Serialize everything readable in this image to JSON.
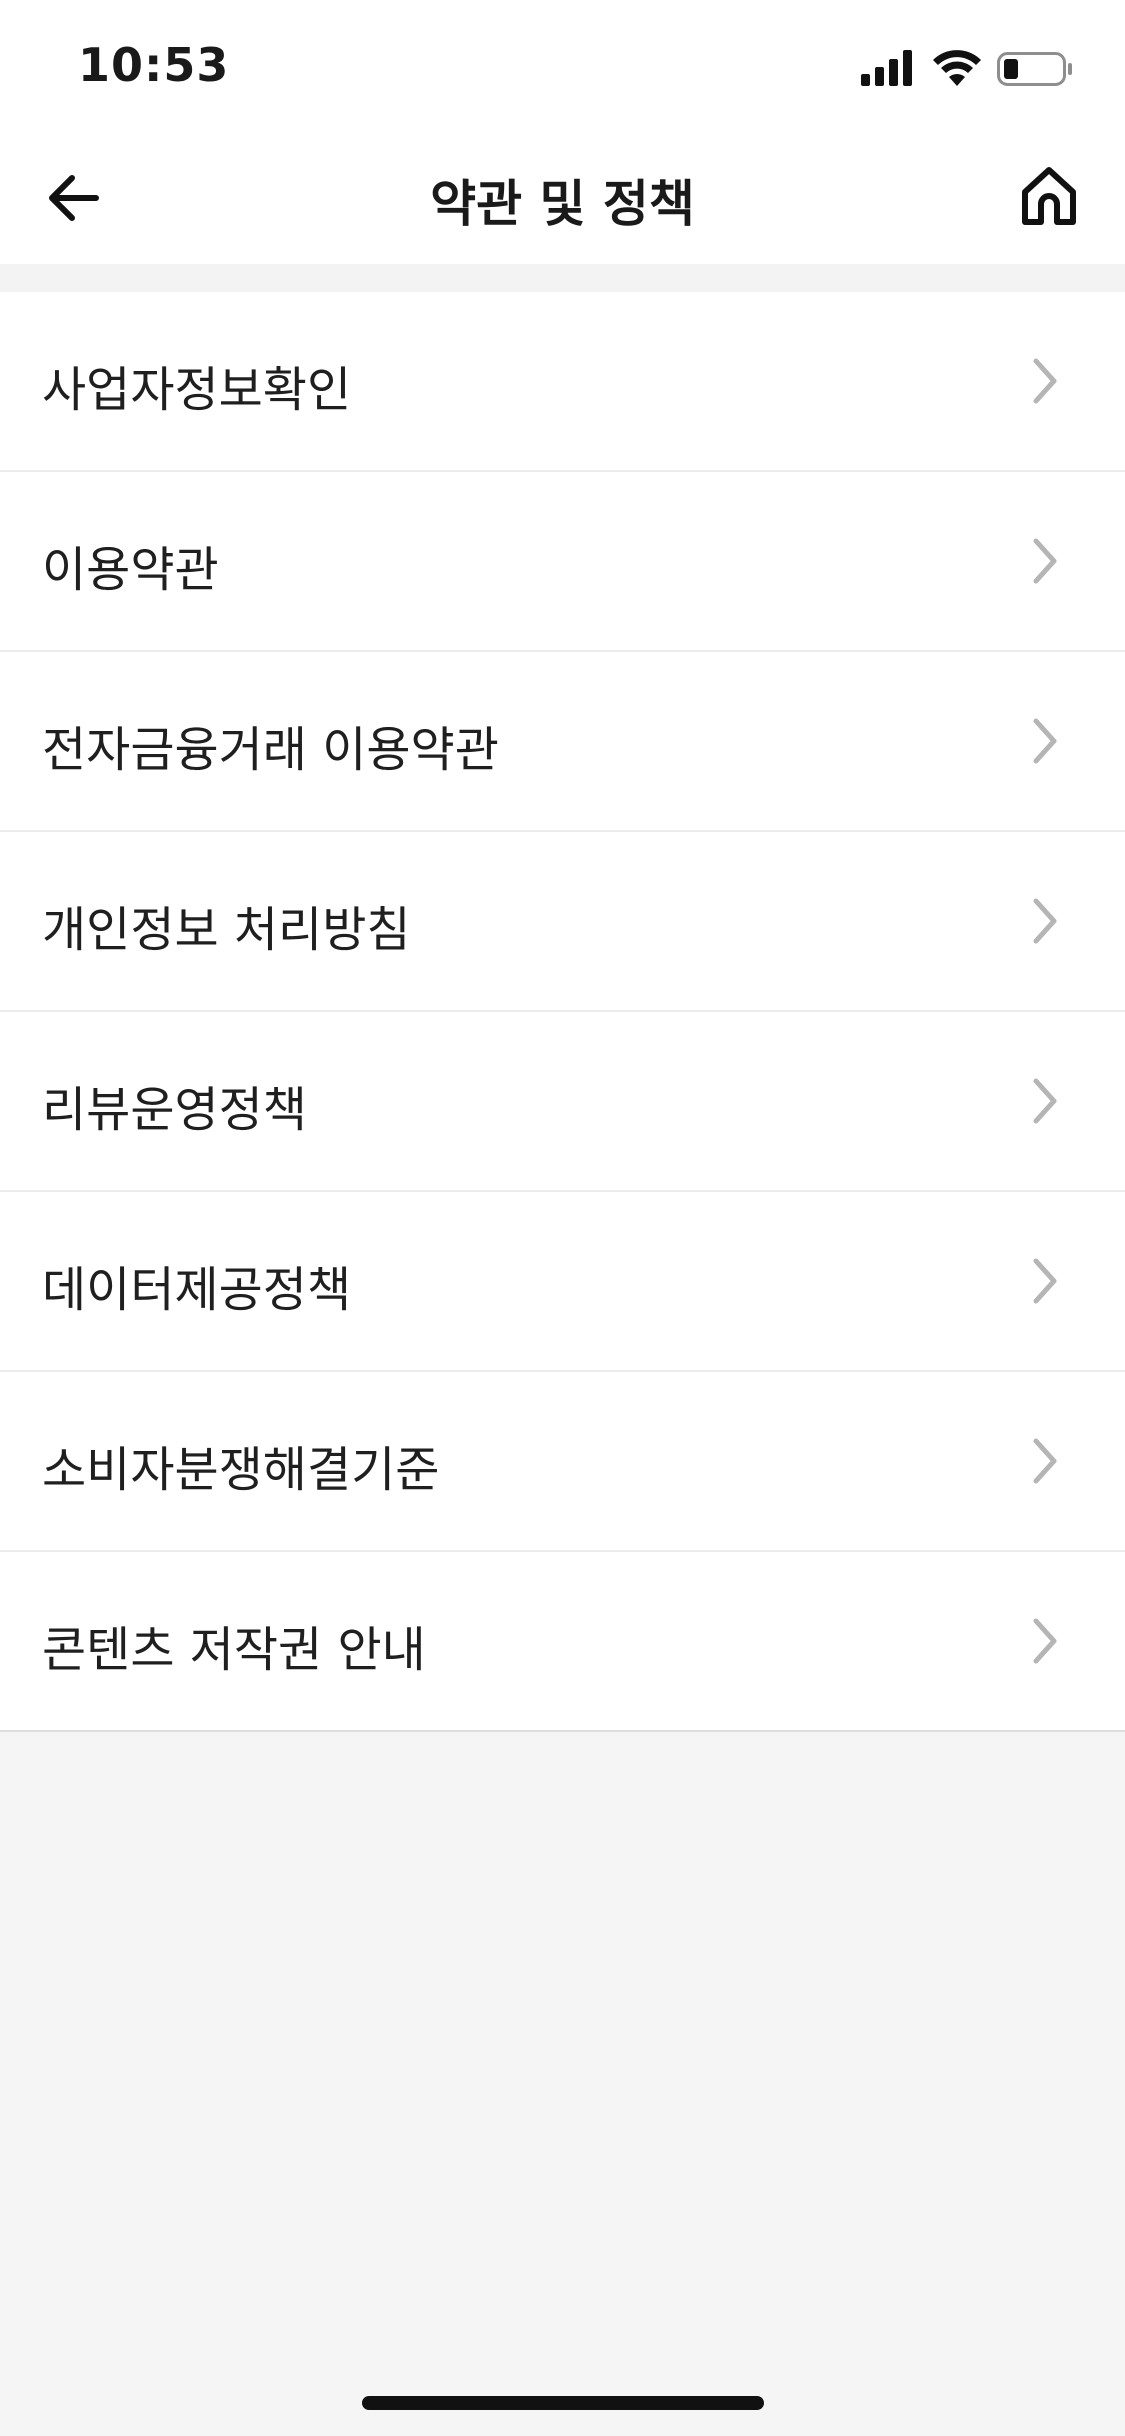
{
  "status_bar": {
    "time": "10:53",
    "icons": [
      "cellular-signal-icon",
      "wifi-icon",
      "battery-icon"
    ]
  },
  "nav": {
    "title": "약관 및 정책",
    "back_icon": "arrow-left-icon",
    "home_icon": "home-icon"
  },
  "menu": {
    "items": [
      {
        "label": "사업자정보확인"
      },
      {
        "label": "이용약관"
      },
      {
        "label": "전자금융거래 이용약관"
      },
      {
        "label": "개인정보 처리방침"
      },
      {
        "label": "리뷰운영정책"
      },
      {
        "label": "데이터제공정책"
      },
      {
        "label": "소비자분쟁해결기준"
      },
      {
        "label": "콘텐츠 저작권 안내"
      }
    ],
    "chevron_icon": "chevron-right-icon",
    "chevron_color": "#b5b5b5"
  },
  "colors": {
    "background": "#f5f5f5",
    "surface": "#ffffff",
    "text": "#1a1a1a"
  }
}
